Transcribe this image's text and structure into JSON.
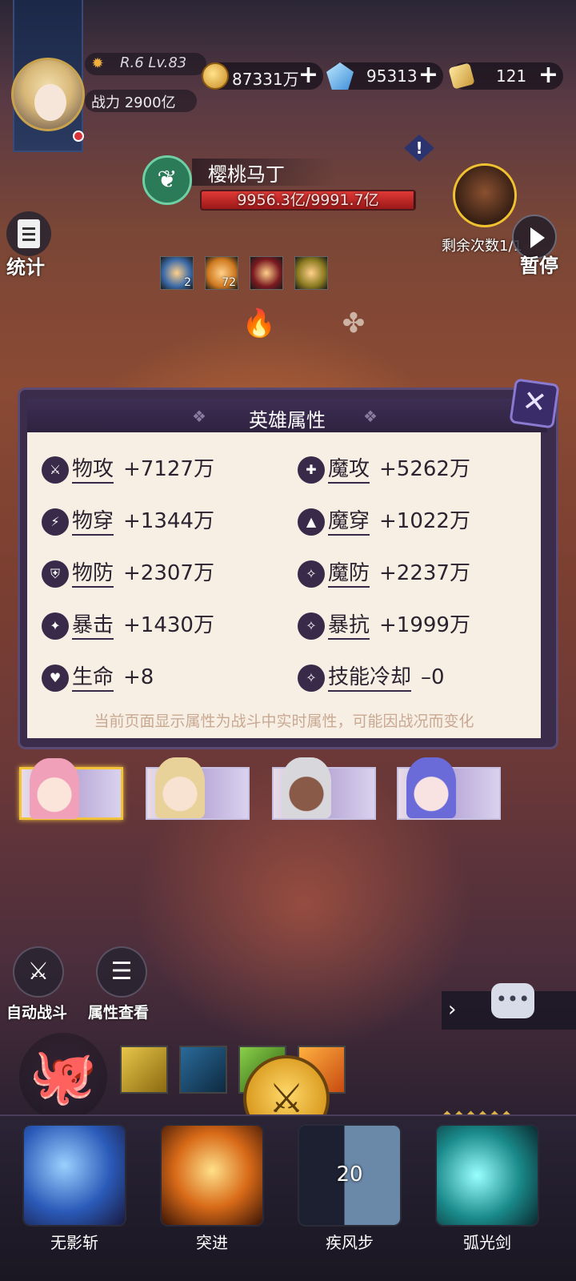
{
  "player": {
    "rank_level": "R.6 Lv.83",
    "power_label": "战力",
    "power_value": "2900亿"
  },
  "resources": [
    {
      "icon": "gold-coin-icon",
      "value": "87331万"
    },
    {
      "icon": "blue-gem-icon",
      "value": "95313"
    },
    {
      "icon": "gold-ticket-icon",
      "value": "121"
    }
  ],
  "boss": {
    "name": "樱桃马丁",
    "hp_text": "9956.3亿/9991.7亿",
    "hp_fraction": 0.9965
  },
  "side": {
    "stats_label": "统计",
    "remaining_label": "剩余次数1/1",
    "pause_label": "暂停"
  },
  "buffs": [
    {
      "count": "2",
      "color": "#3a6aa8"
    },
    {
      "count": "72",
      "color": "#d07a20"
    },
    {
      "count": "",
      "color": "#7a1a20"
    },
    {
      "count": "",
      "color": "#8a7a20"
    }
  ],
  "panel": {
    "title": "英雄属性",
    "left_stats": [
      {
        "name": "物攻",
        "value": "+7127万"
      },
      {
        "name": "物穿",
        "value": "+1344万"
      },
      {
        "name": "物防",
        "value": "+2307万"
      },
      {
        "name": "暴击",
        "value": "+1430万"
      },
      {
        "name": "生命",
        "value": "+8"
      }
    ],
    "right_stats": [
      {
        "name": "魔攻",
        "value": "+5262万"
      },
      {
        "name": "魔穿",
        "value": "+1022万"
      },
      {
        "name": "魔防",
        "value": "+2237万"
      },
      {
        "name": "暴抗",
        "value": "+1999万"
      },
      {
        "name": "技能冷却",
        "value": "–0"
      }
    ],
    "note": "当前页面显示属性为战斗中实时属性，可能因战况而变化"
  },
  "heroes": [
    {
      "hair": "#f0a0b8",
      "selected": true
    },
    {
      "hair": "#e8d29a",
      "selected": false
    },
    {
      "hair": "#d8d8dc",
      "selected": false
    },
    {
      "hair": "#6a6ad8",
      "selected": false
    }
  ],
  "controls": {
    "auto_battle_label": "自动战斗",
    "attr_view_label": "属性查看"
  },
  "skills": [
    {
      "name": "无影斩",
      "cooldown": "",
      "color": "#2a5ab8"
    },
    {
      "name": "突进",
      "cooldown": "",
      "color": "#d86a18"
    },
    {
      "name": "疾风步",
      "cooldown": "20",
      "color": "#3a4a68"
    },
    {
      "name": "弧光剑",
      "cooldown": "",
      "color": "#1a8a8a"
    }
  ],
  "colors": {
    "accent_gold": "#f2c33a",
    "hp_red": "#e03a36",
    "panel_purple": "#3a2c4a"
  }
}
